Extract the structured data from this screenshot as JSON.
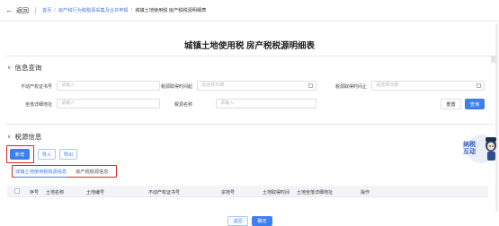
{
  "header": {
    "back_label": "返回",
    "breadcrumb": [
      "首页",
      "房产和行为税税源采集及合并申报",
      "城镇土地使用税 房产税税源明细表"
    ]
  },
  "page_title": "城镇土地使用税 房产税税源明细表",
  "query_section": {
    "title": "信息查询",
    "fields": [
      {
        "label": "不动产权证书号",
        "placeholder": "请输入"
      },
      {
        "label": "税源取得时间起",
        "placeholder": "请选择日期"
      },
      {
        "label": "税源取得时间止",
        "placeholder": "请选择日期"
      },
      {
        "label": "坐落详细地址",
        "placeholder": "请输入"
      },
      {
        "label": "税源名称",
        "placeholder": "请输入"
      }
    ],
    "reset_label": "重置",
    "query_label": "查询"
  },
  "tax_section": {
    "title": "税源信息",
    "new_label": "新增",
    "import_label": "导入",
    "export_label": "导出",
    "tabs": [
      "城镇土地使用税税源信息",
      "房产税税源信息"
    ],
    "columns": [
      "序号",
      "土地名称",
      "土地编号",
      "不动产权证书号",
      "宗地号",
      "土地取得时间",
      "土地坐落详细地址",
      "操作"
    ]
  },
  "footer": {
    "back_label": "返回",
    "confirm_label": "确定"
  },
  "mascot_text": "纳税互动",
  "colors": {
    "accent": "#3d7ff0",
    "highlight": "#d62828"
  }
}
